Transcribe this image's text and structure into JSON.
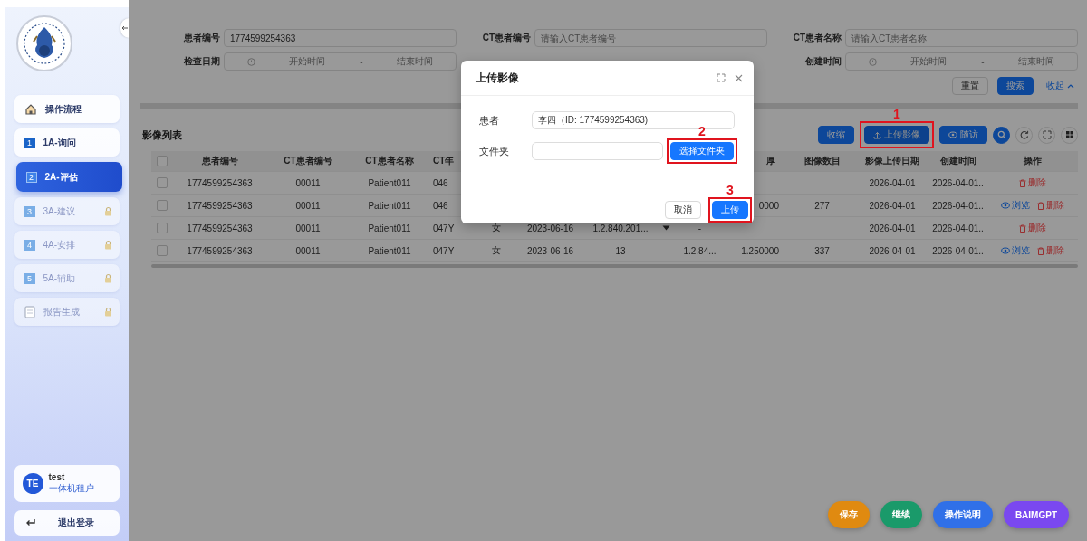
{
  "sidebar": {
    "nav": [
      {
        "kind": "home",
        "label": "操作流程",
        "selected": false,
        "locked": false
      },
      {
        "kind": "step",
        "badge": "1",
        "label": "1A-询问",
        "selected": false,
        "locked": false
      },
      {
        "kind": "step",
        "badge": "2",
        "label": "2A-评估",
        "selected": true,
        "locked": false
      },
      {
        "kind": "step",
        "badge": "3",
        "label": "3A-建议",
        "selected": false,
        "locked": true
      },
      {
        "kind": "step",
        "badge": "4",
        "label": "4A-安排",
        "selected": false,
        "locked": true
      },
      {
        "kind": "step",
        "badge": "5",
        "label": "5A-辅助",
        "selected": false,
        "locked": true
      },
      {
        "kind": "doc",
        "label": "报告生成",
        "selected": false,
        "locked": true
      }
    ],
    "user": {
      "avatar": "TE",
      "name": "test",
      "role": "一体机租户"
    },
    "logout": "退出登录"
  },
  "filters": [
    {
      "kind": "text",
      "label": "患者编号",
      "value": "1774599254363"
    },
    {
      "kind": "text",
      "label": "CT患者编号",
      "placeholder": "请输入CT患者编号"
    },
    {
      "kind": "text",
      "label": "CT患者名称",
      "placeholder": "请输入CT患者名称"
    },
    {
      "kind": "range",
      "label": "检查日期",
      "start": "开始时间",
      "separator": "-",
      "end": "结束时间"
    },
    {
      "kind": "range",
      "label": "创建时间",
      "start": "开始时间",
      "separator": "-",
      "end": "结束时间"
    }
  ],
  "filter_actions": [
    {
      "kind": "plain",
      "label": "重置"
    },
    {
      "kind": "primary",
      "label": "搜索"
    },
    {
      "kind": "link",
      "label": "收起"
    }
  ],
  "table": {
    "title": "影像列表",
    "tools": [
      {
        "kind": "primary",
        "label": "收缩"
      },
      {
        "kind": "upload",
        "label": "上传影像",
        "callout": "1"
      },
      {
        "kind": "eye",
        "label": "随访"
      },
      {
        "kind": "search"
      },
      {
        "kind": "refresh"
      },
      {
        "kind": "fullscreen"
      },
      {
        "kind": "settings"
      }
    ],
    "header_checked": false,
    "columns": [
      "患者编号",
      "CT患者编号",
      "CT患者名称",
      "CT年",
      null,
      null,
      null,
      null,
      "厚",
      "图像数目",
      "影像上传日期",
      "创建时间"
    ],
    "actions_column": "操作",
    "rows": [
      {
        "checked": false,
        "expandable": false,
        "cells": [
          "1774599254363",
          "00011",
          "Patient011",
          "046",
          null,
          null,
          null,
          null,
          null,
          null,
          "2026-04-01",
          "2026-04-01.."
        ],
        "actions": [
          {
            "kind": "delete",
            "label": "删除"
          }
        ]
      },
      {
        "checked": false,
        "expandable": false,
        "cells": [
          "1774599254363",
          "00011",
          "Patient011",
          "046",
          null,
          null,
          null,
          null,
          "0000",
          "277",
          "2026-04-01",
          "2026-04-01.."
        ],
        "actions": [
          {
            "kind": "view",
            "label": "浏览"
          },
          {
            "kind": "delete",
            "label": "删除"
          }
        ]
      },
      {
        "checked": false,
        "expandable": true,
        "cells": [
          "1774599254363",
          "00011",
          "Patient011",
          "047Y",
          "女",
          "2023-06-16",
          "1.2.840.201...",
          "-",
          null,
          null,
          "2026-04-01",
          "2026-04-01.."
        ],
        "actions": [
          {
            "kind": "delete",
            "label": "删除"
          }
        ]
      },
      {
        "checked": false,
        "expandable": false,
        "cells": [
          "1774599254363",
          "00011",
          "Patient011",
          "047Y",
          "女",
          "2023-06-16",
          "13",
          "1.2.84...",
          "1.250000",
          "337",
          "2026-04-01",
          "2026-04-01.."
        ],
        "actions": [
          {
            "kind": "view",
            "label": "浏览"
          },
          {
            "kind": "delete",
            "label": "删除"
          }
        ]
      }
    ]
  },
  "modal": {
    "title": "上传影像",
    "fields": [
      {
        "kind": "text",
        "label": "患者",
        "value": "李四（ID: 1774599254363)"
      },
      {
        "kind": "folder",
        "label": "文件夹",
        "button": "选择文件夹",
        "callout": "2"
      }
    ],
    "buttons": [
      {
        "kind": "plain",
        "label": "取消"
      },
      {
        "kind": "primary",
        "label": "上传",
        "callout": "3"
      }
    ]
  },
  "float_buttons": [
    {
      "label": "保存",
      "color": "#e08a10"
    },
    {
      "label": "继续",
      "color": "#1a9a6a"
    },
    {
      "label": "操作说明",
      "color": "#3070e8"
    },
    {
      "label": "BAIMGPT",
      "color": "#7a48f0"
    }
  ]
}
